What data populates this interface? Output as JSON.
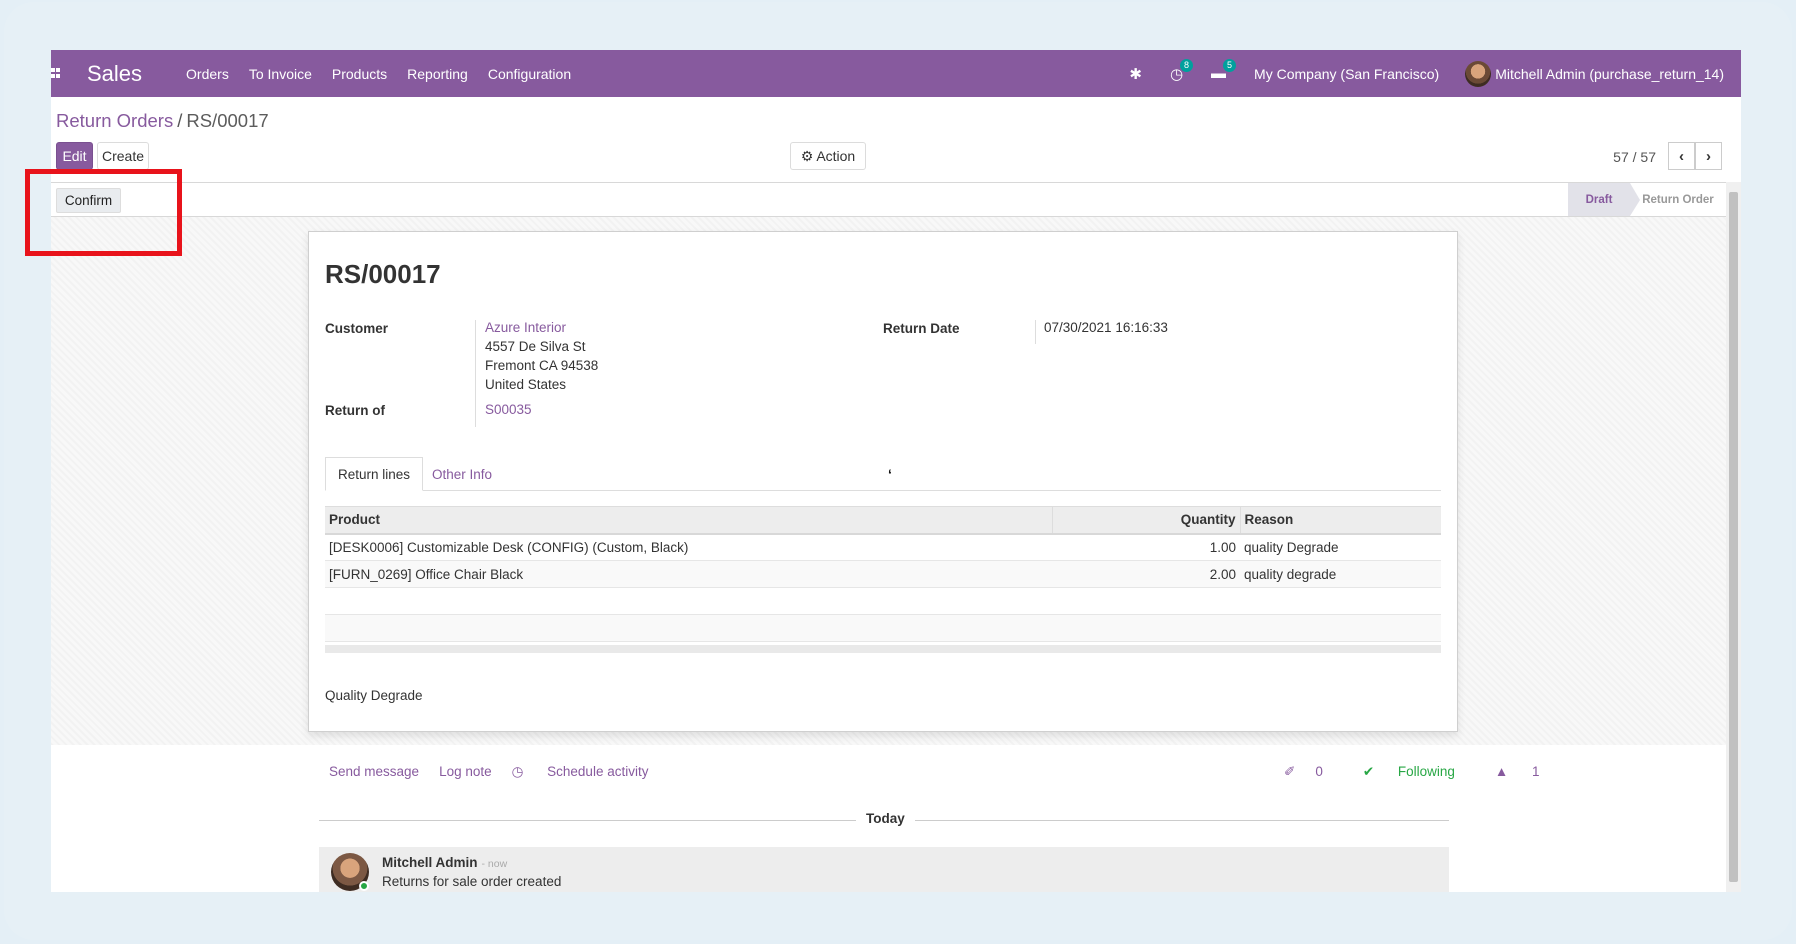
{
  "navbar": {
    "brand": "Sales",
    "menu": [
      "Orders",
      "To Invoice",
      "Products",
      "Reporting",
      "Configuration"
    ],
    "activity_count": "8",
    "message_count": "5",
    "company": "My Company (San Francisco)",
    "user": "Mitchell Admin (purchase_return_14)"
  },
  "breadcrumb": {
    "parent": "Return Orders",
    "separator": "/",
    "current": "RS/00017"
  },
  "buttons": {
    "edit": "Edit",
    "create": "Create",
    "action": "Action",
    "confirm": "Confirm"
  },
  "pager": {
    "value": "57 / 57"
  },
  "statusbar": {
    "stages": [
      "Draft",
      "Return Order"
    ],
    "active": "Draft"
  },
  "record": {
    "name": "RS/00017",
    "customer_label": "Customer",
    "customer_name": "Azure Interior",
    "address_line1": "4557 De Silva St",
    "address_line2": "Fremont CA 94538",
    "address_line3": "United States",
    "return_of_label": "Return of",
    "return_of": "S00035",
    "return_date_label": "Return Date",
    "return_date": "07/30/2021 16:16:33"
  },
  "tabs": [
    "Return lines",
    "Other Info"
  ],
  "lines": {
    "headers": [
      "Product",
      "Quantity",
      "Reason"
    ],
    "rows": [
      [
        "[DESK0006] Customizable Desk (CONFIG) (Custom, Black)",
        "1.00",
        "quality Degrade"
      ],
      [
        "[FURN_0269] Office Chair Black",
        "2.00",
        "quality degrade"
      ]
    ]
  },
  "note": "Quality Degrade",
  "chatter": {
    "send_message": "Send message",
    "log_note": "Log note",
    "schedule_activity": "Schedule activity",
    "attachments": "0",
    "following": "Following",
    "followers": "1",
    "day": "Today",
    "author": "Mitchell Admin",
    "time": "- now",
    "body": "Returns for sale order created"
  },
  "colors": {
    "brand": "#875a9e",
    "highlight": "#e8131b",
    "following": "#28a745"
  }
}
